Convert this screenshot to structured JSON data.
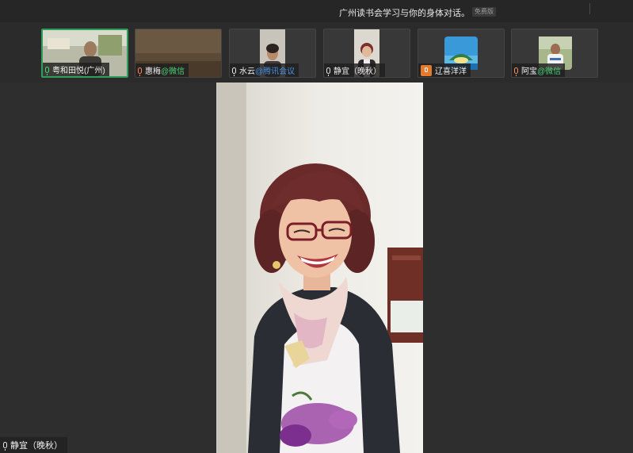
{
  "meeting": {
    "title": "广州读书会学习与你的身体对话。",
    "plan_badge": "免费版"
  },
  "participants": [
    {
      "name": "粤和田悦(广州)",
      "suffix": "",
      "mic": "green",
      "active": true
    },
    {
      "name": "惠梅",
      "suffix": "@微信",
      "mic": "red",
      "active": false
    },
    {
      "name": "水云",
      "suffix": "@腾讯会议",
      "mic": "white",
      "active": false
    },
    {
      "name": "静宜（晚秋）",
      "suffix": "",
      "mic": "white",
      "active": false
    },
    {
      "name": "辽喜洋洋",
      "suffix": "",
      "mic": "muted",
      "active": false
    },
    {
      "name": "阿宝",
      "suffix": "@微信",
      "mic": "red",
      "active": false
    }
  ],
  "speaker": {
    "name": "静宜（晚秋）"
  },
  "icons": {
    "mic": "microphone-icon",
    "muted": "microphone-muted-icon"
  },
  "colors": {
    "active_border": "#2e9e5b",
    "wechat_suffix": "#4bd37a",
    "tencent_suffix": "#4a90e2",
    "muted_badge": "#e67a2c"
  }
}
